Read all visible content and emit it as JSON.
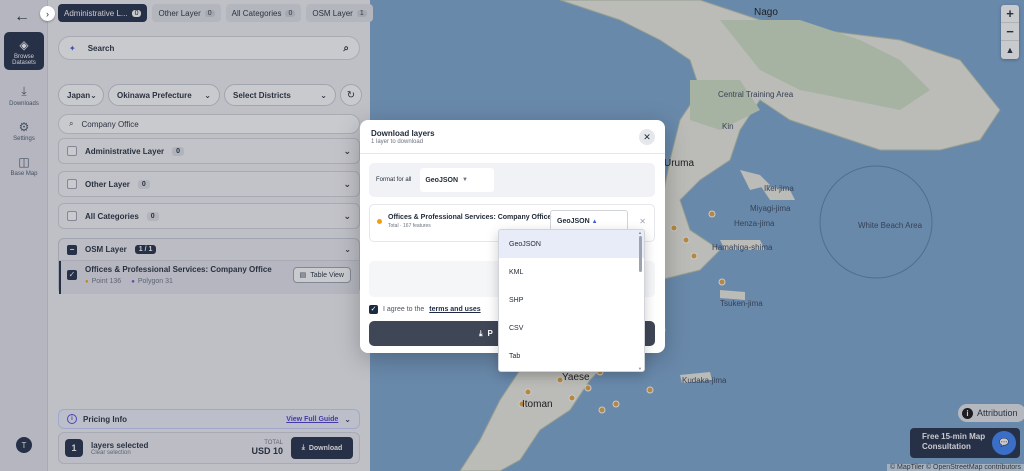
{
  "map": {
    "labels": {
      "nago": "Nago",
      "central_training": "Central Training Area",
      "kin": "Kin",
      "uruma": "Uruma",
      "ikei": "Ikei-jima",
      "miyagi": "Miyagi-jima",
      "henza": "Henza-jima",
      "hamahiga": "Hamahiga-shima",
      "tsuken": "Tsuken-jima",
      "kudaka": "Kudaka-jima",
      "yaese": "Yaese",
      "naha": "Itoman",
      "white_beach": "White Beach Area"
    },
    "zoom_in": "+",
    "zoom_out": "−",
    "compass": "▲",
    "attribution": "Attribution",
    "attribution_icon": "i",
    "copyright": "© MapTiler © OpenStreetMap contributors",
    "consult_line1": "Free 15-min Map",
    "consult_line2": "Consultation",
    "chat_icon": "💬"
  },
  "nav": {
    "back": "←",
    "items": [
      {
        "icon": "◈",
        "label": "Browse Datasets"
      },
      {
        "icon": "⤓",
        "label": "Downloads"
      },
      {
        "icon": "⚙",
        "label": "Settings"
      },
      {
        "icon": "◫",
        "label": "Base Map"
      }
    ],
    "avatar": "T"
  },
  "panel": {
    "collapse": "›",
    "tabs": [
      {
        "label": "Administrative L...",
        "count": "0"
      },
      {
        "label": "Other Layer",
        "count": "0"
      },
      {
        "label": "All Categories",
        "count": "0"
      },
      {
        "label": "OSM Layer",
        "count": "1"
      }
    ],
    "search_placeholder": "Search",
    "search_spark": "✦",
    "search_icon": "⌕",
    "filters": {
      "country": "Japan",
      "prefecture": "Okinawa Prefecture",
      "districts": "Select Districts",
      "chevron": "⌄",
      "refresh": "↻"
    },
    "company_search": "Company Office",
    "accordions": [
      {
        "label": "Administrative Layer",
        "count": "0"
      },
      {
        "label": "Other Layer",
        "count": "0"
      },
      {
        "label": "All Categories",
        "count": "0"
      }
    ],
    "acc_chev": "⌄",
    "osm": {
      "label": "OSM Layer",
      "count": "1 / 1",
      "check": "−",
      "row_check": "✓",
      "row_title": "Offices & Professional Services: Company Office",
      "points": "Point 136",
      "polygons": "Polygon 31",
      "table_view": "Table View",
      "table_icon": "▤"
    },
    "pricing": {
      "label": "Pricing Info",
      "icon": "i",
      "guide": "View Full Guide",
      "chev": "⌄"
    },
    "summary": {
      "count": "1",
      "label": "layers selected",
      "clear": "Clear selection",
      "total_label": "TOTAL",
      "total_value": "USD 10",
      "download": "Download",
      "download_icon": "⤓"
    }
  },
  "modal": {
    "title": "Download layers",
    "subtitle": "1 layer to download",
    "close": "✕",
    "format_all_label": "Format for all",
    "format_all_value": "GeoJSON",
    "format_all_arrow": "▼",
    "layer_name": "Offices & Professional Services: Company Office",
    "layer_sub": "Total · 167 features",
    "layer_format": "GeoJSON",
    "layer_arrow": "▲",
    "remove": "✕",
    "price_text": "US",
    "agree_check": "✓",
    "agree_text": "I agree to the",
    "agree_link": "terms and uses",
    "button_icon": "⤓",
    "button_text": "P"
  },
  "dropdown": {
    "options": [
      "GeoJSON",
      "KML",
      "SHP",
      "CSV",
      "Tab"
    ],
    "selected": "GeoJSON",
    "up": "▲",
    "down": "▼"
  }
}
